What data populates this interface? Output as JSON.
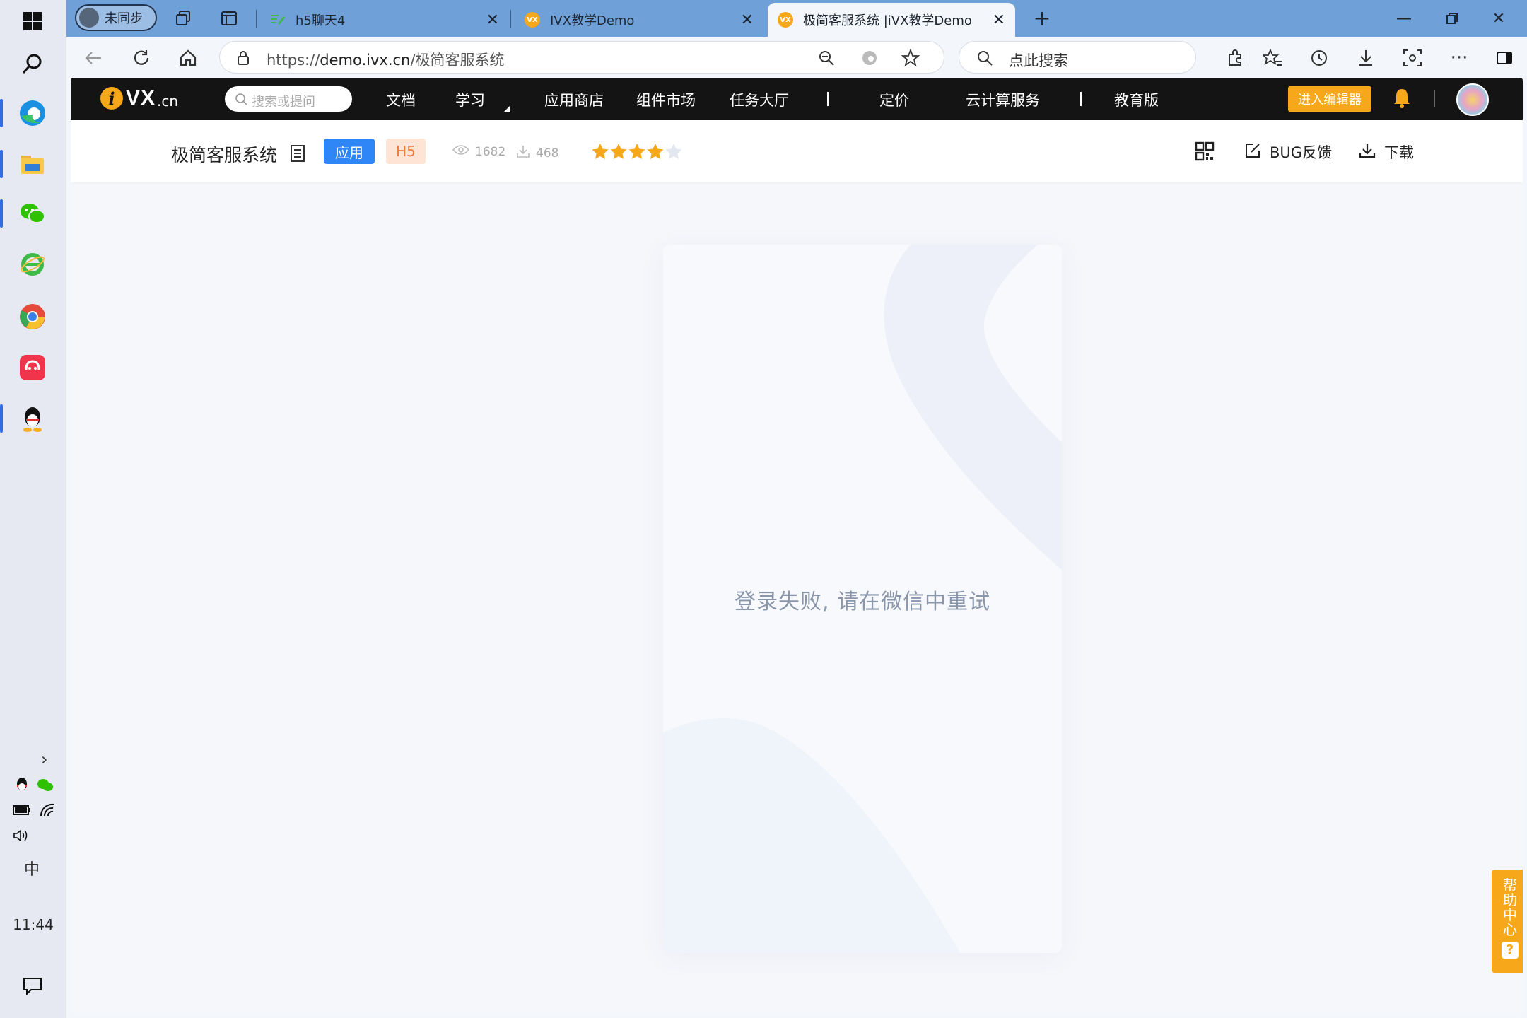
{
  "taskbar": {
    "time": "11:44",
    "ime": "中"
  },
  "browser": {
    "profile_label": "未同步",
    "tabs": [
      {
        "title": "h5聊天4"
      },
      {
        "title": "IVX教学Demo"
      },
      {
        "title": "极简客服系统 |iVX教学Demo"
      }
    ],
    "address": {
      "url_prefix": "https://",
      "url_host": "demo.ivx.cn",
      "url_path": "/极简客服系统"
    },
    "search_placeholder": "点此搜索"
  },
  "ivx": {
    "logo_text": "VX",
    "logo_suffix": ".cn",
    "search_placeholder": "搜索或提问",
    "nav": [
      "文档",
      "学习",
      "应用商店",
      "组件市场",
      "任务大厅",
      "定价",
      "云计算服务",
      "教育版"
    ],
    "editor_button": "进入编辑器",
    "accent_color": "#f6a81a"
  },
  "app": {
    "title": "极简客服系统",
    "tag_app": "应用",
    "tag_h5": "H5",
    "views": "1682",
    "downloads": "468",
    "rating": 4,
    "rating_max": 5,
    "qr_label": "",
    "bug_label": "BUG反馈",
    "download_label": "下载"
  },
  "phone": {
    "error_message": "登录失败, 请在微信中重试"
  },
  "help": {
    "label": "帮助中心",
    "icon": "?"
  }
}
